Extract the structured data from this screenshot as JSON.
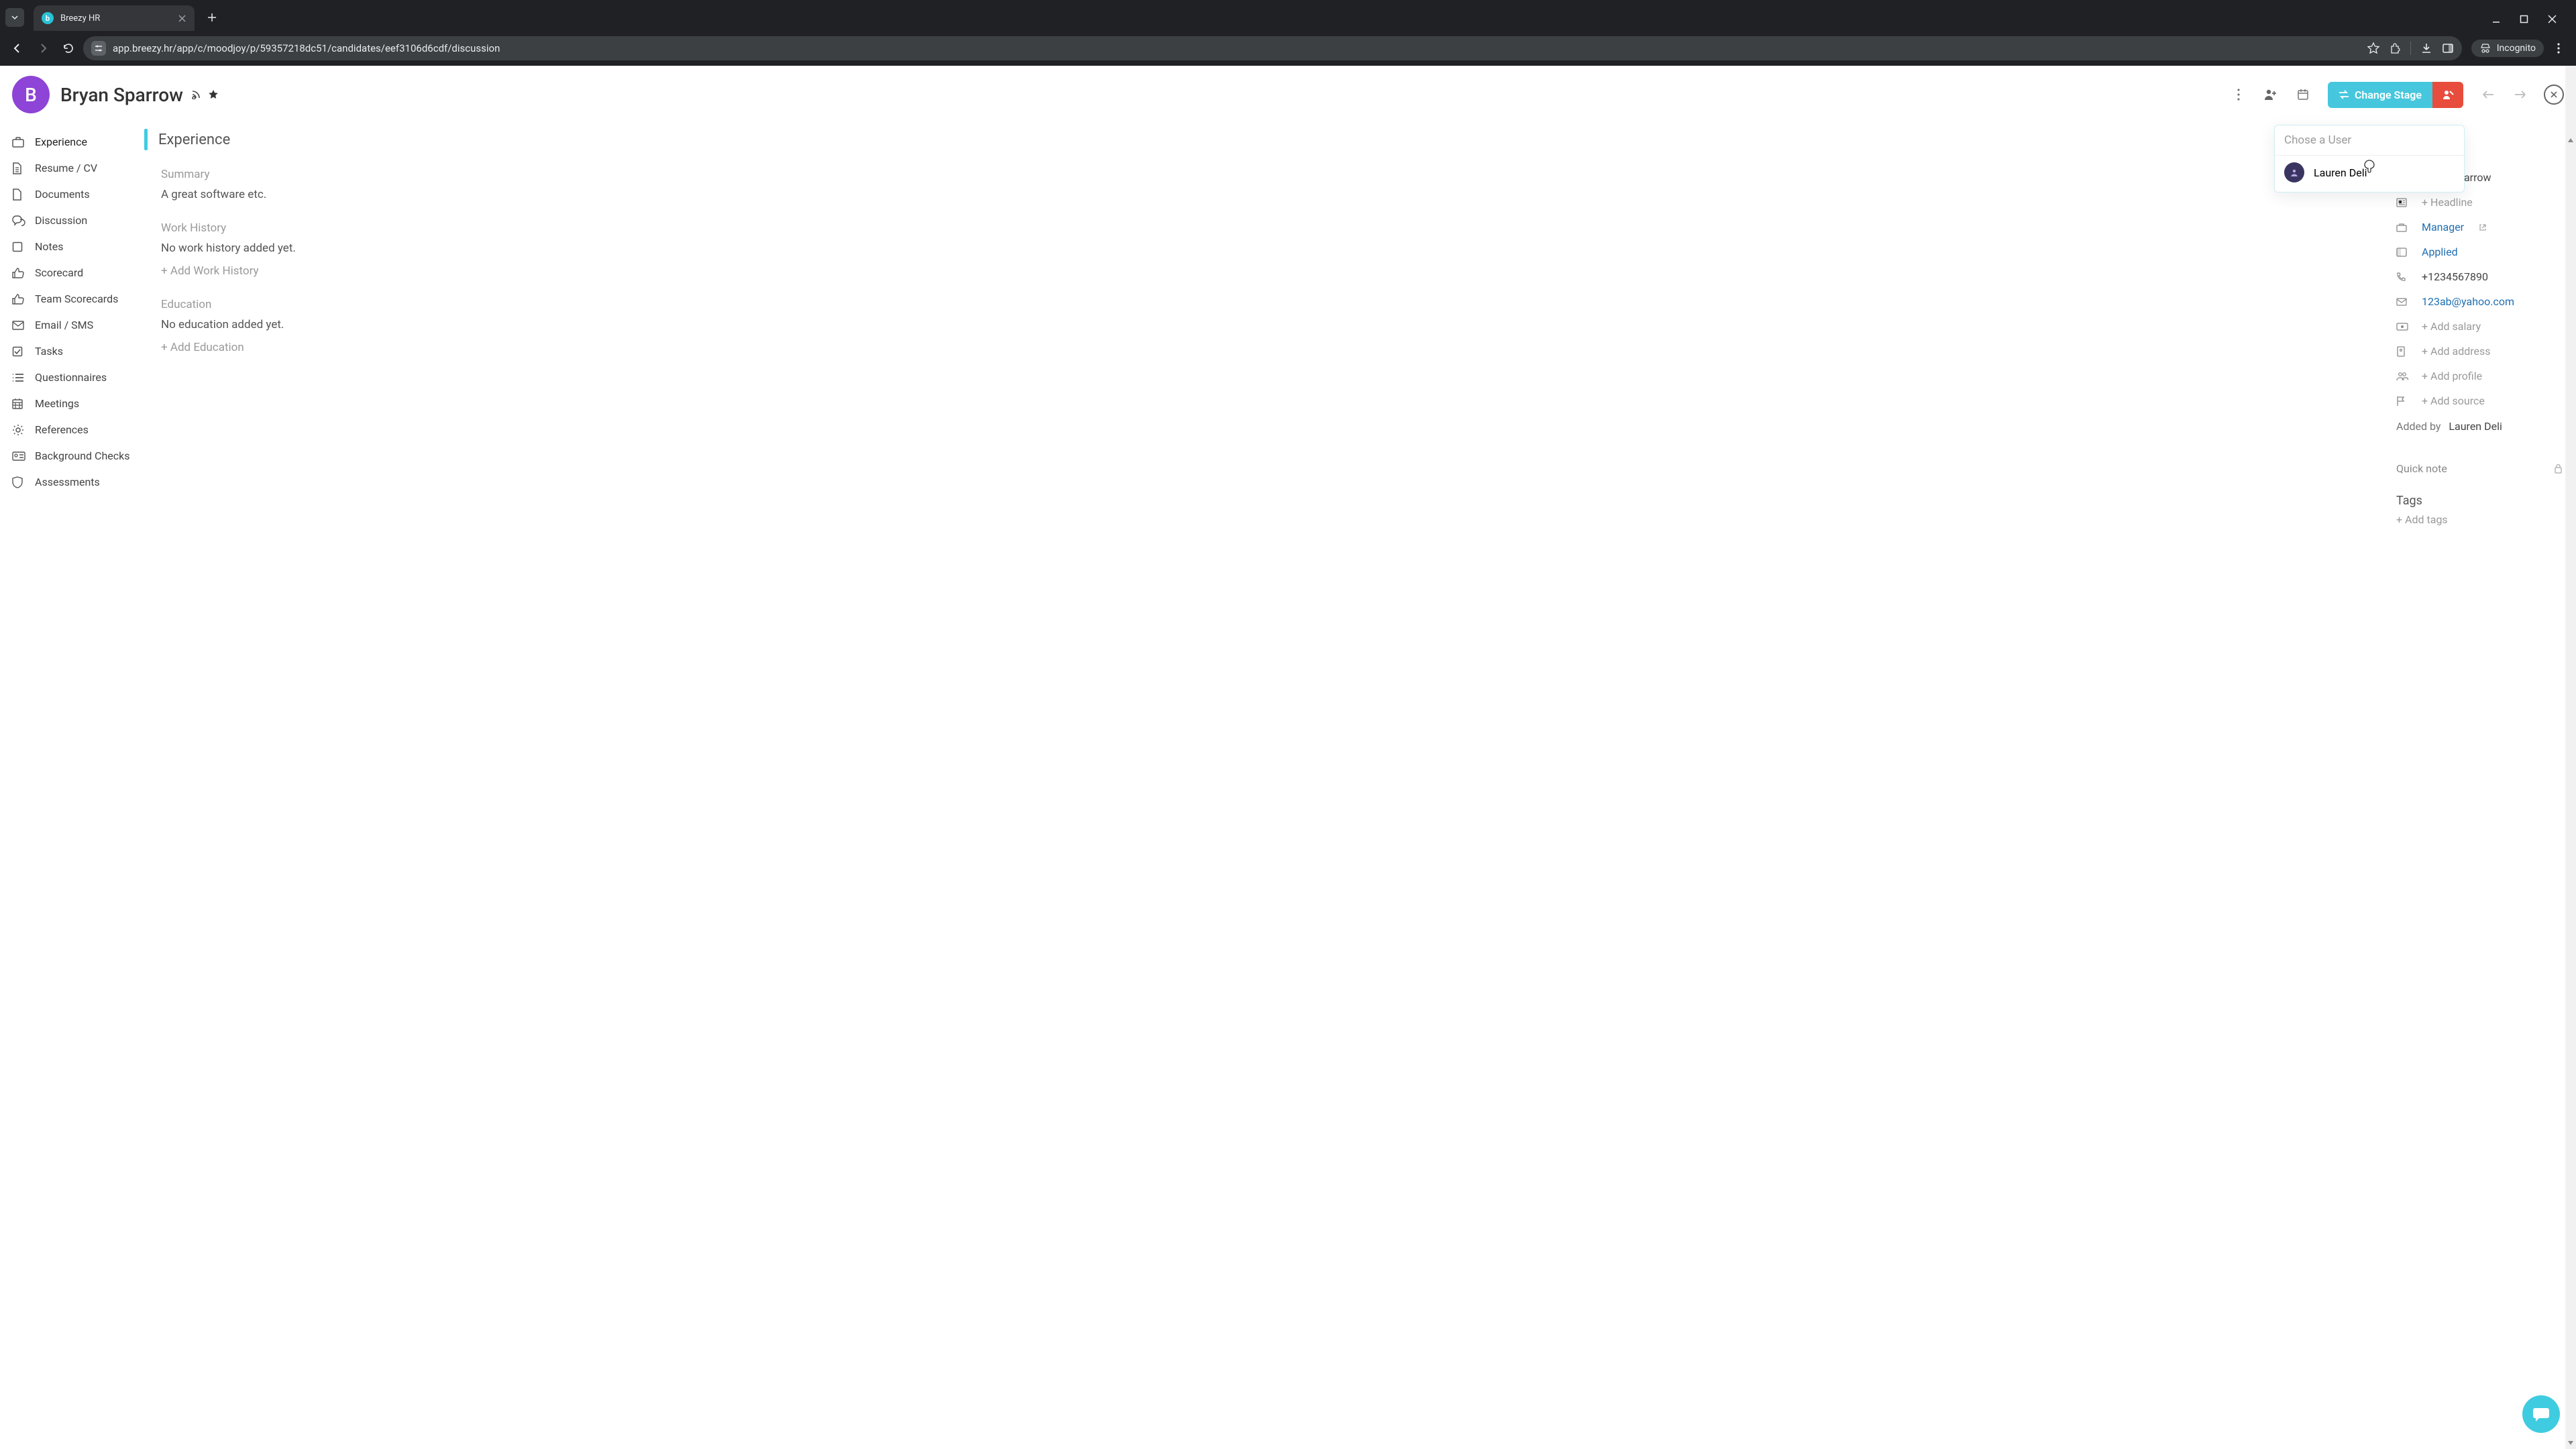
{
  "browser": {
    "tab_title": "Breezy HR",
    "url": "app.breezy.hr/app/c/moodjoy/p/59357218dc51/candidates/eef3106d6cdf/discussion",
    "incognito_label": "Incognito"
  },
  "header": {
    "avatar_letter": "B",
    "candidate_name": "Bryan Sparrow",
    "change_stage_label": "Change Stage"
  },
  "leftnav": {
    "items": [
      {
        "label": "Experience",
        "icon": "briefcase"
      },
      {
        "label": "Resume / CV",
        "icon": "file"
      },
      {
        "label": "Documents",
        "icon": "doc"
      },
      {
        "label": "Discussion",
        "icon": "chat"
      },
      {
        "label": "Notes",
        "icon": "note"
      },
      {
        "label": "Scorecard",
        "icon": "thumbs"
      },
      {
        "label": "Team Scorecards",
        "icon": "thumbs"
      },
      {
        "label": "Email / SMS",
        "icon": "envelope"
      },
      {
        "label": "Tasks",
        "icon": "check"
      },
      {
        "label": "Questionnaires",
        "icon": "list"
      },
      {
        "label": "Meetings",
        "icon": "calendar-grid"
      },
      {
        "label": "References",
        "icon": "gear"
      },
      {
        "label": "Background Checks",
        "icon": "id"
      },
      {
        "label": "Assessments",
        "icon": "shield"
      }
    ]
  },
  "main": {
    "section_title": "Experience",
    "summary_label": "Summary",
    "summary_text": "A great software etc.",
    "work_history_label": "Work History",
    "work_history_empty": "No work history added yet.",
    "add_work_history": "+ Add Work History",
    "education_label": "Education",
    "education_empty": "No education added yet.",
    "add_education": "+ Add Education"
  },
  "user_dropdown": {
    "placeholder": "Chose a User",
    "option_name": "Lauren Deli"
  },
  "details": {
    "name": "Bryan Sparrow",
    "headline_placeholder": "+ Headline",
    "role": "Manager",
    "stage": "Applied",
    "phone": "+1234567890",
    "email": "123ab@yahoo.com",
    "salary_placeholder": "+ Add salary",
    "address_placeholder": "+ Add address",
    "profile_placeholder": "+ Add profile",
    "source_placeholder": "+ Add source",
    "added_by_label": "Added by",
    "added_by_name": "Lauren Deli",
    "quick_note_placeholder": "Quick note",
    "tags_title": "Tags",
    "add_tags": "+ Add tags"
  }
}
